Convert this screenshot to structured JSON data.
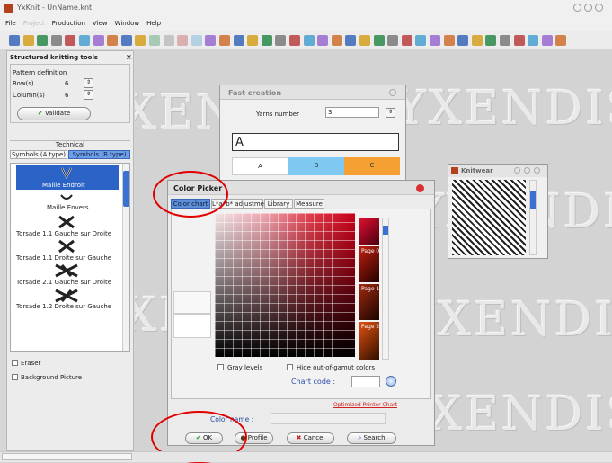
{
  "window": {
    "title": "YxKnit - UnName.knt",
    "controls": [
      "minimize",
      "maximize",
      "close"
    ]
  },
  "menubar": {
    "items": [
      "File",
      "Project",
      "Production",
      "View",
      "Window",
      "Help"
    ]
  },
  "toolbar": {
    "icon_count": 40
  },
  "left_panel": {
    "title": "Structured knitting tools",
    "pattern_label": "Pattern definition",
    "rows_label": "Row(s)",
    "rows_value": "6",
    "cols_label": "Column(s)",
    "cols_value": "6",
    "validate_label": "Validate",
    "technical_label": "Technical",
    "tabs": [
      "Symbols (A type)",
      "Symbols (B type)"
    ],
    "symbols": [
      "Maille Endroit",
      "Maille Envers",
      "Torsade 1.1 Gauche sur Droite",
      "Torsade 1.1 Droite sur Gauche",
      "Torsade 2.1 Gauche sur Droite",
      "Torsade 1.2 Droite sur Gauche"
    ],
    "eraser_label": "Eraser",
    "background_label": "Background Picture"
  },
  "fast_creation": {
    "title": "Fast creation",
    "yarns_label": "Yarns number",
    "yarns_value": "3",
    "name_value": "A",
    "yarns": [
      {
        "label": "A",
        "color": "#ffffff"
      },
      {
        "label": "B",
        "color": "#7ec8f2"
      },
      {
        "label": "C",
        "color": "#f5a033"
      }
    ]
  },
  "knitwear": {
    "title": "Knitwear"
  },
  "color_picker": {
    "title": "Color Picker",
    "tabs": [
      "Color chart",
      "L*a*b* adjustment",
      "Library",
      "Measure"
    ],
    "pages": [
      "Page 0",
      "Page 1",
      "Page 2"
    ],
    "gray_label": "Gray levels",
    "gamut_label": "Hide out-of-gamut colors",
    "chart_code_label": "Chart code :",
    "printer_link": "Optimized Printer Chart",
    "color_name_label": "Color name :",
    "buttons": {
      "ok": "OK",
      "profile": "Profile",
      "cancel": "Cancel",
      "search": "Search"
    },
    "colors": {
      "accent_red": "#e00000",
      "header_blue": "#3a4e8a"
    }
  },
  "workspace": {
    "watermark": "YXENDIS"
  }
}
